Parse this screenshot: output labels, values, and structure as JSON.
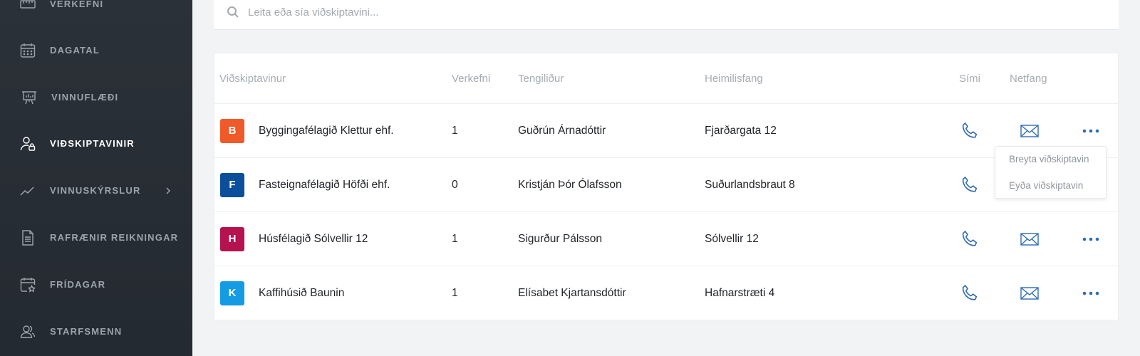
{
  "colors": {
    "sidebar_bg": "#2b3138",
    "accent_blue": "#2f6db3",
    "avatar_B": "#f05a28",
    "avatar_F": "#0b4f9c",
    "avatar_H": "#b5124f",
    "avatar_K": "#139ce4"
  },
  "sidebar": {
    "items": [
      {
        "label": "VERKEFNI",
        "icon": "ruler-icon"
      },
      {
        "label": "DAGATAL",
        "icon": "calendar-icon"
      },
      {
        "label": "VINNUFLÆÐI",
        "icon": "presentation-board-icon"
      },
      {
        "label": "VIÐSKIPTAVINIR",
        "icon": "user-lock-icon",
        "active": true
      },
      {
        "label": "VINNUSKÝRSLUR",
        "icon": "trend-line-icon",
        "has_submenu": true
      },
      {
        "label": "RAFRÆNIR REIKNINGAR",
        "icon": "document-icon"
      },
      {
        "label": "FRÍDAGAR",
        "icon": "calendar-star-icon"
      },
      {
        "label": "STARFSMENN",
        "icon": "users-icon"
      }
    ]
  },
  "search": {
    "placeholder": "Leita eða sía viðskiptavini..."
  },
  "table": {
    "headers": {
      "customer": "Viðskiptavinur",
      "projects": "Verkefni",
      "contact": "Tengiliður",
      "address": "Heimilisfang",
      "phone": "Sími",
      "email": "Netfang"
    },
    "rows": [
      {
        "initial": "B",
        "name": "Byggingafélagið Klettur ehf.",
        "projects": "1",
        "contact": "Guðrún Árnadóttir",
        "address": "Fjarðargata 12"
      },
      {
        "initial": "F",
        "name": "Fasteignafélagið Höfði ehf.",
        "projects": "0",
        "contact": "Kristján Þór Ólafsson",
        "address": "Suðurlandsbraut 8"
      },
      {
        "initial": "H",
        "name": "Húsfélagið Sólvellir 12",
        "projects": "1",
        "contact": "Sigurður Pálsson",
        "address": "Sólvellir 12"
      },
      {
        "initial": "K",
        "name": "Kaffihúsið Baunin",
        "projects": "1",
        "contact": "Elísabet Kjartansdóttir",
        "address": "Hafnarstræti 4"
      }
    ]
  },
  "dropdown": {
    "edit_label": "Breyta viðskiptavin",
    "delete_label": "Eyða viðskiptavin"
  }
}
